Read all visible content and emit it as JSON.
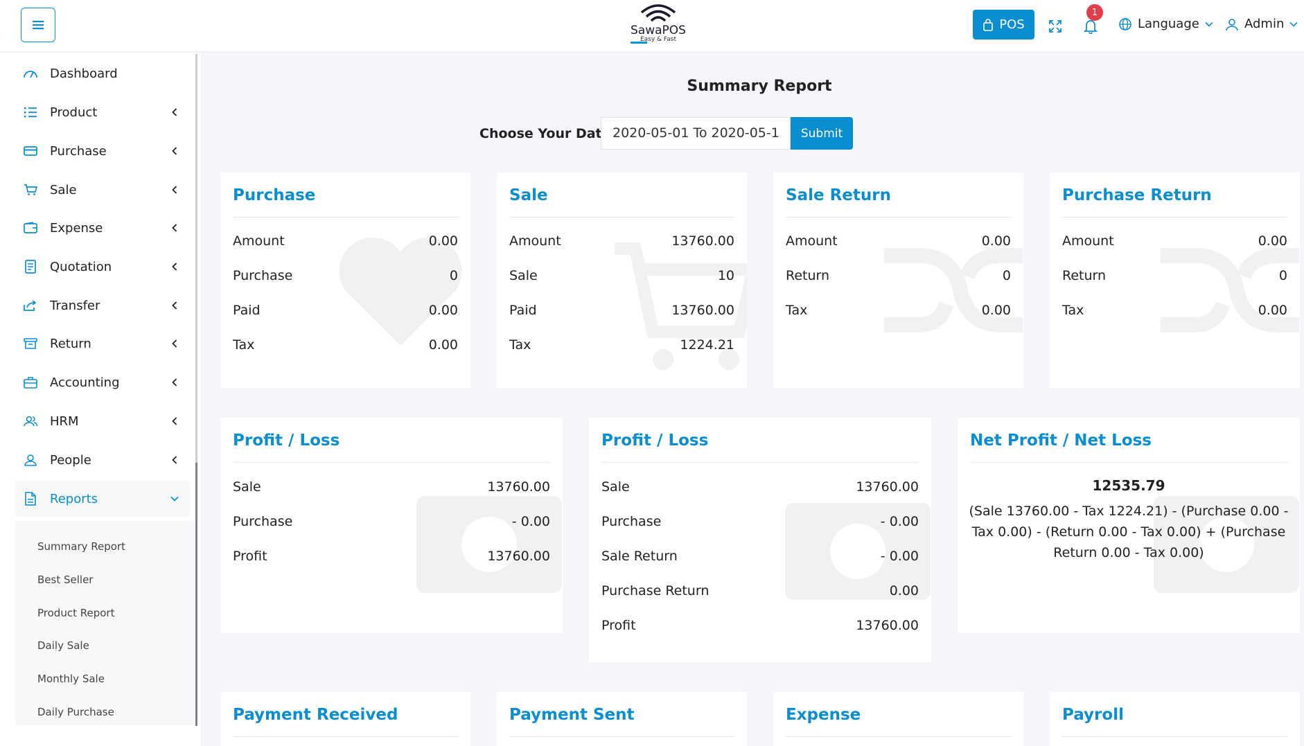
{
  "header": {
    "logo_name": "SawaPOS",
    "logo_tagline": "Easy & Fast",
    "pos_label": "POS",
    "notification_count": "1",
    "language_label": "Language",
    "user_label": "Admin"
  },
  "sidebar": {
    "items": [
      {
        "label": "Dashboard",
        "icon": "dashboard-icon"
      },
      {
        "label": "Product",
        "icon": "list-icon"
      },
      {
        "label": "Purchase",
        "icon": "card-icon"
      },
      {
        "label": "Sale",
        "icon": "cart-icon"
      },
      {
        "label": "Expense",
        "icon": "wallet-icon"
      },
      {
        "label": "Quotation",
        "icon": "document-icon"
      },
      {
        "label": "Transfer",
        "icon": "share-icon"
      },
      {
        "label": "Return",
        "icon": "box-icon"
      },
      {
        "label": "Accounting",
        "icon": "briefcase-icon"
      },
      {
        "label": "HRM",
        "icon": "users-icon"
      },
      {
        "label": "People",
        "icon": "user-icon"
      },
      {
        "label": "Reports",
        "icon": "report-icon"
      }
    ],
    "reports_submenu": [
      "Summary Report",
      "Best Seller",
      "Product Report",
      "Daily Sale",
      "Monthly Sale",
      "Daily Purchase"
    ]
  },
  "main": {
    "title": "Summary Report",
    "date_label": "Choose Your Date",
    "date_value": "2020-05-01 To 2020-05-1",
    "submit_label": "Submit"
  },
  "cards_top": [
    {
      "title": "Purchase",
      "rows": [
        [
          "Amount",
          "0.00"
        ],
        [
          "Purchase",
          "0"
        ],
        [
          "Paid",
          "0.00"
        ],
        [
          "Tax",
          "0.00"
        ]
      ]
    },
    {
      "title": "Sale",
      "rows": [
        [
          "Amount",
          "13760.00"
        ],
        [
          "Sale",
          "10"
        ],
        [
          "Paid",
          "13760.00"
        ],
        [
          "Tax",
          "1224.21"
        ]
      ]
    },
    {
      "title": "Sale Return",
      "rows": [
        [
          "Amount",
          "0.00"
        ],
        [
          "Return",
          "0"
        ],
        [
          "Tax",
          "0.00"
        ]
      ]
    },
    {
      "title": "Purchase Return",
      "rows": [
        [
          "Amount",
          "0.00"
        ],
        [
          "Return",
          "0"
        ],
        [
          "Tax",
          "0.00"
        ]
      ]
    }
  ],
  "cards_mid": [
    {
      "title": "Profit / Loss",
      "rows": [
        [
          "Sale",
          "13760.00"
        ],
        [
          "Purchase",
          "- 0.00"
        ],
        [
          "Profit",
          "13760.00"
        ]
      ]
    },
    {
      "title": "Profit / Loss",
      "rows": [
        [
          "Sale",
          "13760.00"
        ],
        [
          "Purchase",
          "- 0.00"
        ],
        [
          "Sale Return",
          "- 0.00"
        ],
        [
          "Purchase Return",
          "0.00"
        ],
        [
          "Profit",
          "13760.00"
        ]
      ]
    },
    {
      "title": "Net Profit / Net Loss",
      "value": "12535.79",
      "formula": "(Sale 13760.00 - Tax 1224.21) - (Purchase 0.00 - Tax 0.00) - (Return 0.00 - Tax 0.00) + (Purchase Return 0.00 - Tax 0.00)"
    }
  ],
  "cards_bottom": [
    {
      "title": "Payment Received"
    },
    {
      "title": "Payment Sent"
    },
    {
      "title": "Expense"
    },
    {
      "title": "Payroll"
    }
  ],
  "colors": {
    "accent": "#0a8ed2",
    "badge": "#e23d4b"
  }
}
